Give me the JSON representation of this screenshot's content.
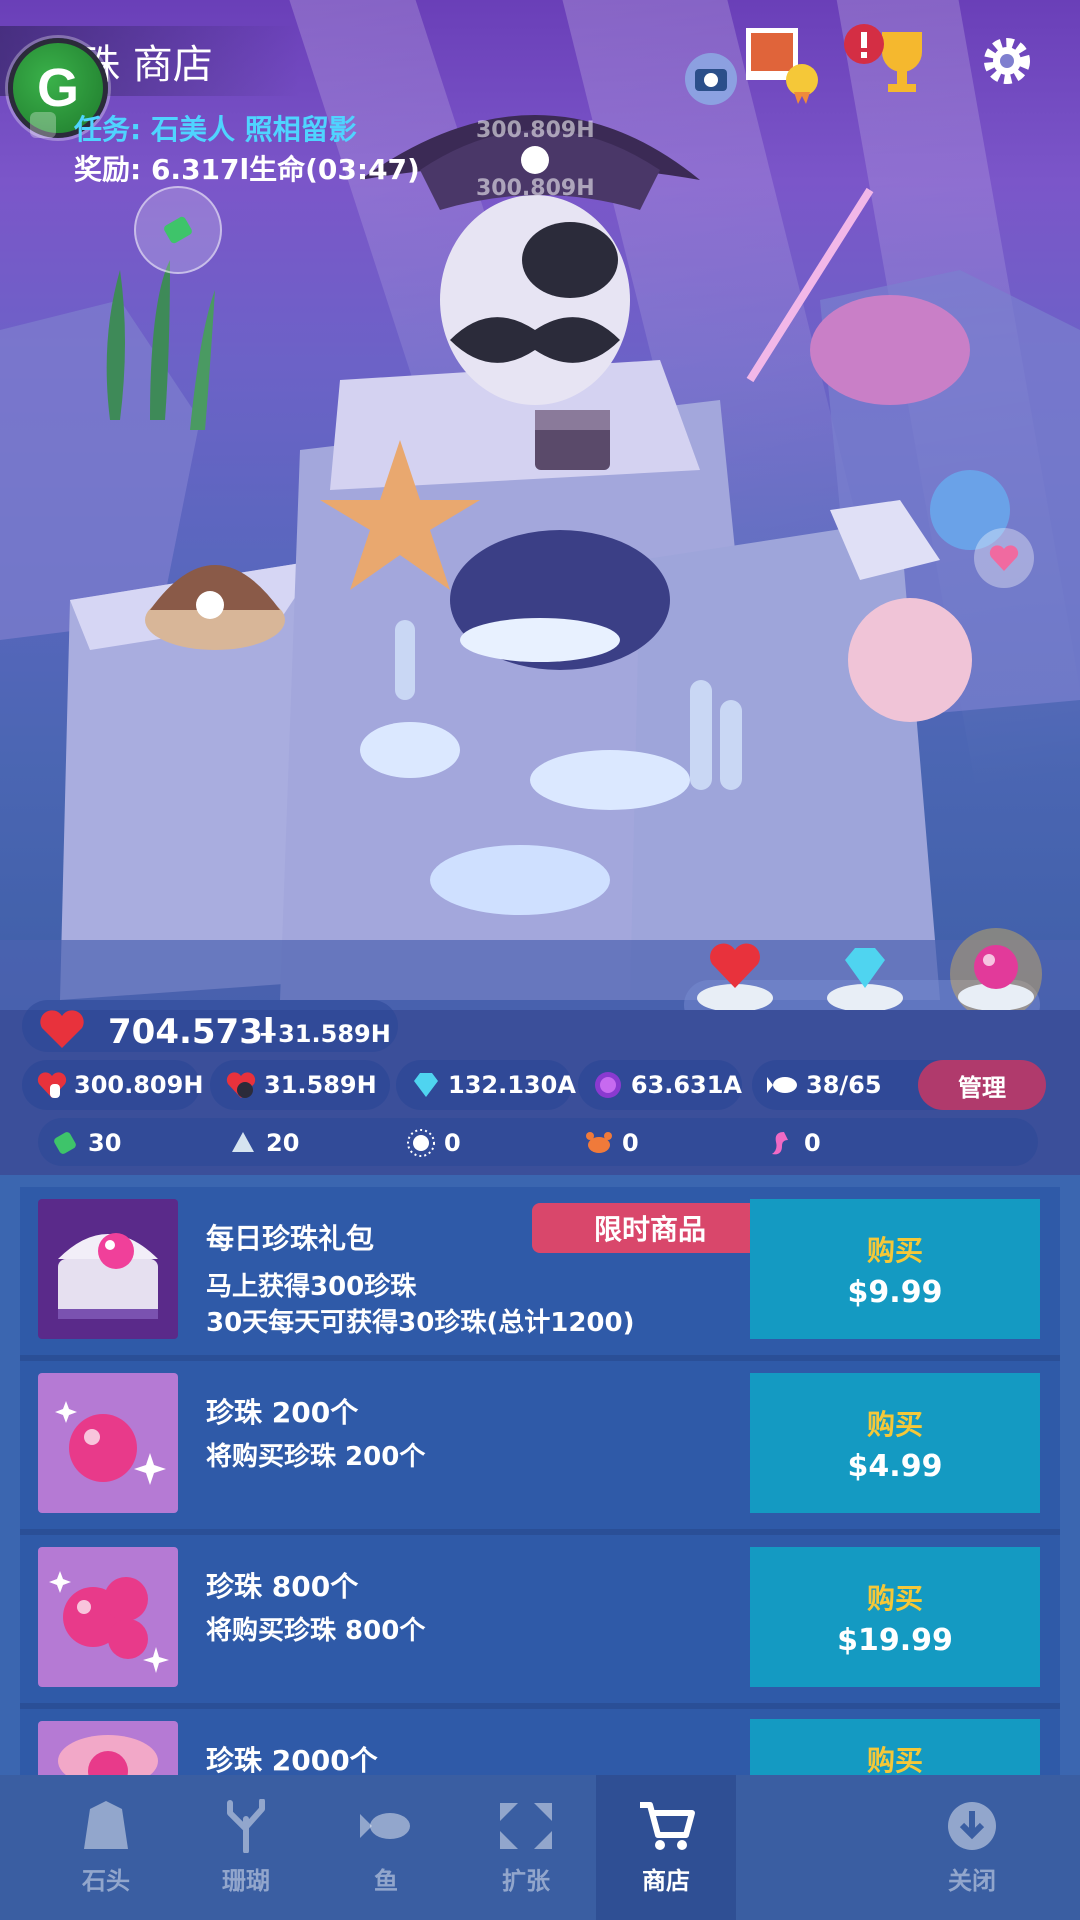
{
  "header": {
    "title": "珠 商店",
    "quest": "任务: 石美人 照相留影",
    "reward": "奖励: 6.317l生命(03:47)"
  },
  "scene": {
    "float_value_1": "300.809H",
    "float_value_2": "300.809H"
  },
  "resources": {
    "life_total": "704.573l",
    "life_rate": "+31.589H",
    "tap_life": "300.809H",
    "auto_life": "31.589H",
    "diamonds": "132.130A",
    "pearls": "63.631A",
    "fish": "38/65",
    "manage_label": "管理"
  },
  "collectibles": [
    {
      "icon": "green-coral-icon",
      "count": "30"
    },
    {
      "icon": "white-shell-icon",
      "count": "20"
    },
    {
      "icon": "sea-urchin-icon",
      "count": "0"
    },
    {
      "icon": "crab-icon",
      "count": "0"
    },
    {
      "icon": "seahorse-icon",
      "count": "0"
    }
  ],
  "shop": {
    "items": [
      {
        "name": "每日珍珠礼包",
        "tag": "限时商品",
        "desc_line1": "马上获得300珍珠",
        "desc_line2": "30天每天可获得30珍珠(总计1200)",
        "buy_label": "购买",
        "price": "$9.99"
      },
      {
        "name": "珍珠 200个",
        "desc_line1": "将购买珍珠 200个",
        "buy_label": "购买",
        "price": "$4.99"
      },
      {
        "name": "珍珠 800个",
        "desc_line1": "将购买珍珠 800个",
        "buy_label": "购买",
        "price": "$19.99"
      },
      {
        "name": "珍珠 2000个",
        "buy_label": "购买"
      }
    ]
  },
  "nav": {
    "tabs": [
      {
        "label": "石头",
        "icon": "rock-icon"
      },
      {
        "label": "珊瑚",
        "icon": "coral-icon"
      },
      {
        "label": "鱼",
        "icon": "fish-icon"
      },
      {
        "label": "扩张",
        "icon": "expand-icon"
      },
      {
        "label": "商店",
        "icon": "cart-icon",
        "active": true
      },
      {
        "label": "关闭",
        "icon": "close-down-icon"
      }
    ]
  },
  "colors": {
    "accent_pink": "#d9476b",
    "buy_button": "#149ac2",
    "buy_label": "#f5c838",
    "manage_button": "#b03a6c"
  }
}
